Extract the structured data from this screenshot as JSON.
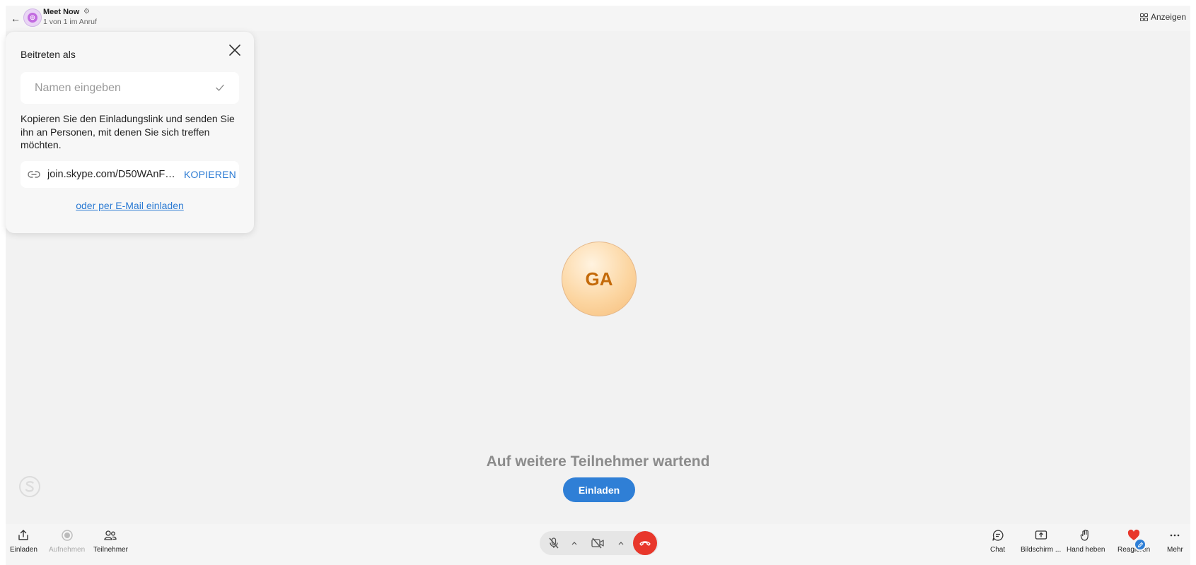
{
  "header": {
    "title": "Meet Now",
    "subtitle": "1 von 1 im Anruf",
    "view_label": "Anzeigen"
  },
  "invite_panel": {
    "title": "Beitreten als",
    "name_placeholder": "Namen eingeben",
    "name_value": "",
    "description": "Kopieren Sie den Einladungslink und senden Sie ihn an Personen, mit denen Sie sich treffen möchten.",
    "link_text": "join.skype.com/D50WAnF…",
    "copy_label": "KOPIEREN",
    "email_link": "oder per E-Mail einladen"
  },
  "stage": {
    "avatar_initials": "GA",
    "waiting_text": "Auf weitere Teilnehmer wartend",
    "invite_button": "Einladen"
  },
  "toolbar": {
    "left": [
      {
        "label": "Einladen",
        "icon": "share-icon"
      },
      {
        "label": "Aufnehmen",
        "icon": "record-icon"
      },
      {
        "label": "Teilnehmer",
        "icon": "participants-icon"
      }
    ],
    "right": [
      {
        "label": "Chat",
        "icon": "chat-icon"
      },
      {
        "label": "Bildschirm ...",
        "icon": "screen-share-icon"
      },
      {
        "label": "Hand heben",
        "icon": "raise-hand-icon"
      },
      {
        "label": "Reagieren",
        "icon": "heart-icon"
      },
      {
        "label": "Mehr",
        "icon": "more-icon"
      }
    ]
  },
  "colors": {
    "accent": "#2f7fd6",
    "hangup": "#e8372b",
    "avatar_text": "#c46a0a",
    "heart": "#e8372b"
  }
}
